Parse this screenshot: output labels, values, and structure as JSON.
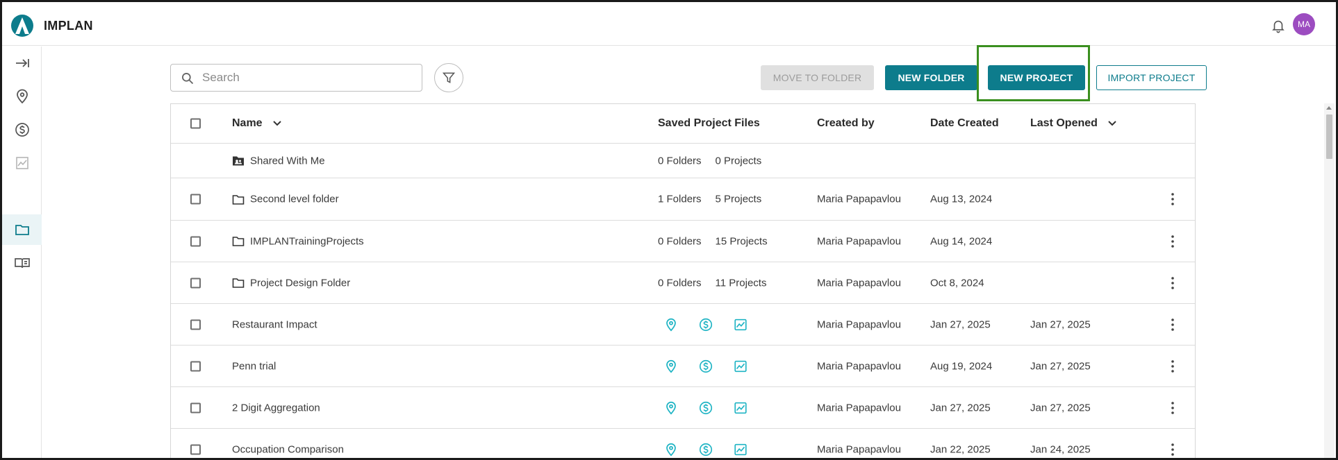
{
  "app": {
    "title": "IMPLAN",
    "user_initials": "MA"
  },
  "colors": {
    "brand": "#0d7c8c",
    "accent_icon": "#1fb4c4",
    "avatar": "#9c4cc0",
    "highlight": "#3a8f1f"
  },
  "sidebar": {
    "items": [
      {
        "name": "expand",
        "icon": "arrow-right-bar-icon"
      },
      {
        "name": "regions",
        "icon": "map-pin-icon"
      },
      {
        "name": "impacts",
        "icon": "dollar-circle-icon"
      },
      {
        "name": "results",
        "icon": "line-chart-icon"
      },
      {
        "name": "projects",
        "icon": "folder-icon",
        "active": true
      },
      {
        "name": "library",
        "icon": "book-icon"
      }
    ]
  },
  "toolbar": {
    "search_placeholder": "Search",
    "move_to_folder": "MOVE TO FOLDER",
    "new_folder": "NEW FOLDER",
    "new_project": "NEW PROJECT",
    "import_project": "IMPORT PROJECT"
  },
  "table": {
    "columns": {
      "name": "Name",
      "files": "Saved Project Files",
      "created_by": "Created by",
      "date_created": "Date Created",
      "last_opened": "Last Opened"
    },
    "shared": {
      "name": "Shared With Me",
      "folders": "0 Folders",
      "projects": "0 Projects"
    },
    "folders": [
      {
        "name": "Second level folder",
        "folders": "1 Folders",
        "projects": "5 Projects",
        "created_by": "Maria Papapavlou",
        "date_created": "Aug 13, 2024",
        "last_opened": ""
      },
      {
        "name": "IMPLANTrainingProjects",
        "folders": "0 Folders",
        "projects": "15 Projects",
        "created_by": "Maria Papapavlou",
        "date_created": "Aug 14, 2024",
        "last_opened": ""
      },
      {
        "name": "Project Design Folder",
        "folders": "0 Folders",
        "projects": "11 Projects",
        "created_by": "Maria Papapavlou",
        "date_created": "Oct 8, 2024",
        "last_opened": ""
      }
    ],
    "projects": [
      {
        "name": "Restaurant Impact",
        "created_by": "Maria Papapavlou",
        "date_created": "Jan 27, 2025",
        "last_opened": "Jan 27, 2025"
      },
      {
        "name": "Penn trial",
        "created_by": "Maria Papapavlou",
        "date_created": "Aug 19, 2024",
        "last_opened": "Jan 27, 2025"
      },
      {
        "name": "2 Digit Aggregation",
        "created_by": "Maria Papapavlou",
        "date_created": "Jan 27, 2025",
        "last_opened": "Jan 27, 2025"
      },
      {
        "name": "Occupation Comparison",
        "created_by": "Maria Papapavlou",
        "date_created": "Jan 22, 2025",
        "last_opened": "Jan 24, 2025"
      }
    ]
  }
}
